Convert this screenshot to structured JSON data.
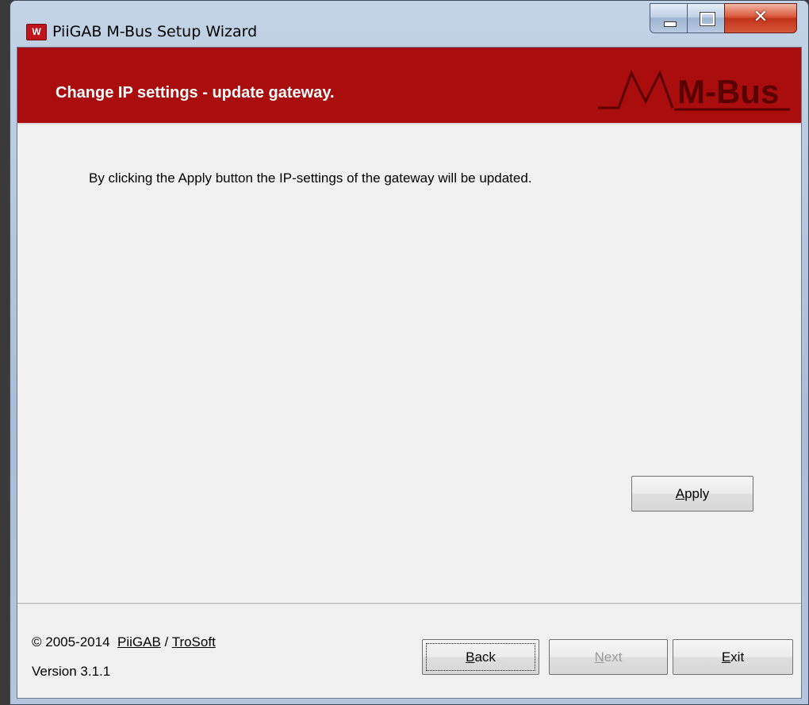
{
  "window": {
    "title": "PiiGAB M-Bus Setup Wizard",
    "icon_letter": "W",
    "controls": [
      "minimize",
      "maximize",
      "close"
    ]
  },
  "header": {
    "title": "Change IP settings - update gateway.",
    "logo_text": "M-Bus",
    "background_color": "#aa0d0d"
  },
  "main": {
    "description": "By clicking the Apply button the IP-settings of the gateway will be updated.",
    "apply_button": {
      "label_prefix": "",
      "label_accel": "A",
      "label_rest": "pply"
    }
  },
  "footer": {
    "copyright_prefix": "© 2005-2014",
    "link1": "PiiGAB",
    "separator": "/",
    "link2": "TroSoft",
    "version": "Version 3.1.1",
    "back": {
      "accel": "B",
      "rest": "ack",
      "enabled": true,
      "focused": true
    },
    "next": {
      "accel": "N",
      "rest": "ext",
      "enabled": false
    },
    "exit": {
      "accel": "E",
      "rest": "xit",
      "enabled": true
    }
  }
}
